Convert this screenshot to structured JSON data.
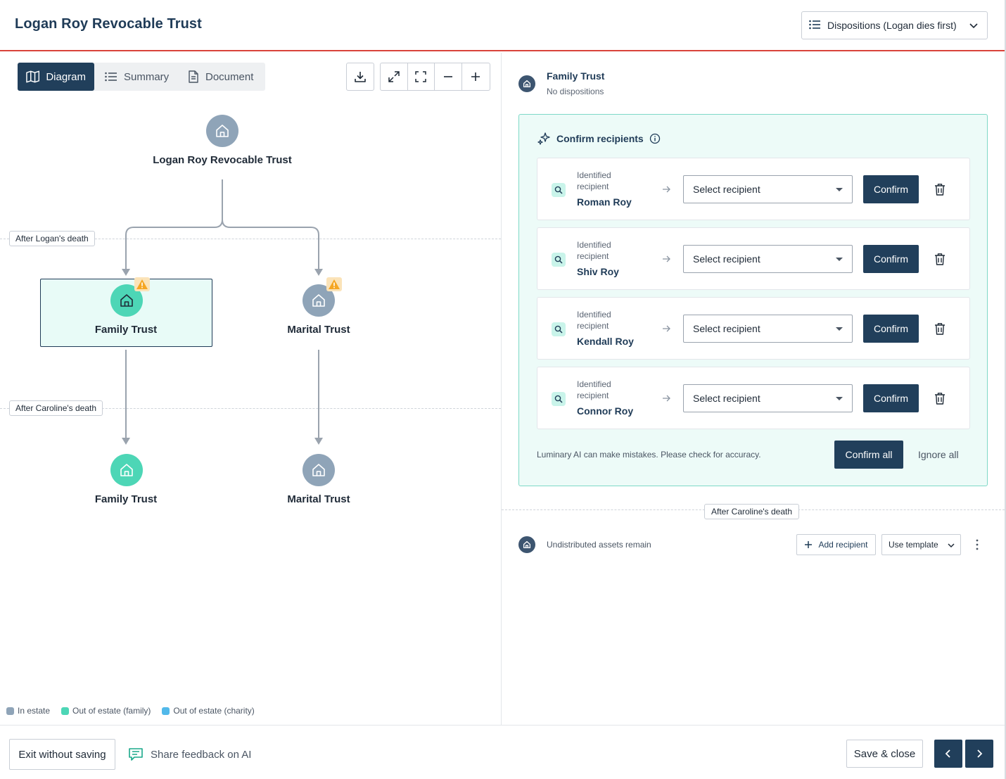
{
  "header": {
    "title": "Logan Roy Revocable Trust",
    "scenario_dropdown": "Dispositions (Logan dies first)"
  },
  "view_tabs": [
    {
      "label": "Diagram",
      "active": true
    },
    {
      "label": "Summary",
      "active": false
    },
    {
      "label": "Document",
      "active": false
    }
  ],
  "diagram": {
    "root": "Logan Roy Revocable Trust",
    "section_labels": [
      "After Logan's death",
      "After Caroline's death"
    ],
    "level1": [
      "Family Trust",
      "Marital Trust"
    ],
    "level2": [
      "Family Trust",
      "Marital Trust"
    ]
  },
  "legend": [
    {
      "label": "In estate",
      "color": "#8fa4b8"
    },
    {
      "label": "Out of estate (family)",
      "color": "#4dd6b6"
    },
    {
      "label": "Out of estate (charity)",
      "color": "#52b9ea"
    }
  ],
  "entity": {
    "name": "Family Trust",
    "status": "No dispositions"
  },
  "confirm": {
    "title": "Confirm recipients",
    "identified_label": "Identified recipient",
    "select_placeholder": "Select recipient",
    "confirm_label": "Confirm",
    "recipients": [
      "Roman Roy",
      "Shiv Roy",
      "Kendall Roy",
      "Connor Roy"
    ],
    "disclaimer": "Luminary AI can make mistakes. Please check for accuracy.",
    "confirm_all": "Confirm all",
    "ignore_all": "Ignore all"
  },
  "after_section": {
    "label": "After Caroline's death",
    "undistributed": "Undistributed assets remain",
    "add_recipient": "Add recipient",
    "use_template": "Use template"
  },
  "footer": {
    "exit": "Exit without saving",
    "feedback": "Share feedback on AI",
    "save": "Save & close"
  },
  "colors": {
    "primary": "#213f5b",
    "accent_red": "#d9433b",
    "teal": "#4dd6b6",
    "warning": "#f5a623"
  }
}
